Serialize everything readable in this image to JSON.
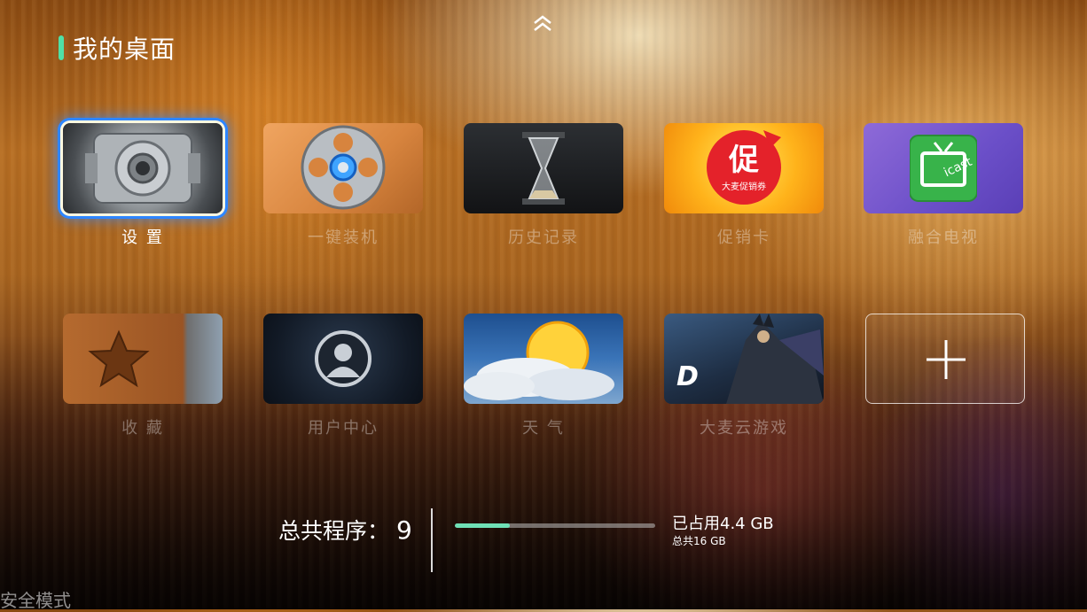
{
  "header": {
    "title": "我的桌面"
  },
  "apps": [
    {
      "label": "设 置",
      "icon": "gear-icon",
      "selected": true
    },
    {
      "label": "一键装机",
      "icon": "film-reel-icon"
    },
    {
      "label": "历史记录",
      "icon": "hourglass-icon"
    },
    {
      "label": "促销卡",
      "icon": "promo-badge-icon",
      "badge_char": "促",
      "badge_sub": "大麦促销券"
    },
    {
      "label": "融合电视",
      "icon": "tv-icast-icon",
      "badge_text": "icast"
    },
    {
      "label": "收 藏",
      "icon": "star-icon"
    },
    {
      "label": "用户中心",
      "icon": "user-icon"
    },
    {
      "label": "天 气",
      "icon": "sun-cloud-icon"
    },
    {
      "label": "大麦云游戏",
      "icon": "game-icon",
      "badge_char": "D"
    },
    {
      "label": "",
      "icon": "plus-icon"
    }
  ],
  "footer": {
    "program_count_label": "总共程序：",
    "program_count": "9",
    "storage_used": "已占用4.4 GB",
    "storage_total": "总共16 GB",
    "storage_fraction": 0.275
  },
  "safe_mode": "安全模式",
  "colors": {
    "accent": "#4fe0a6",
    "focus": "#2e86ff",
    "progress": "#6fe0b6"
  }
}
